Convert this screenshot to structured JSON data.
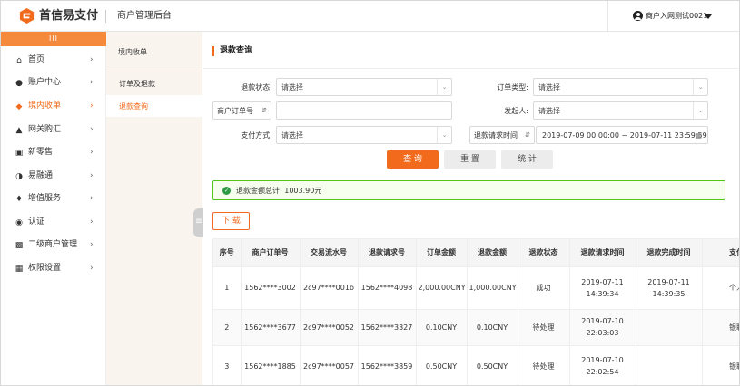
{
  "header": {
    "logo_text": "首信易支付",
    "system_title": "商户管理后台",
    "user_name": "商户入网测试0021"
  },
  "sidebar": {
    "collapse_glyph": "III",
    "items": [
      {
        "label": "首页",
        "icon": "home-icon"
      },
      {
        "label": "账户中心",
        "icon": "user-icon"
      },
      {
        "label": "境内收单",
        "icon": "layers-icon"
      },
      {
        "label": "网关购汇",
        "icon": "bank-icon"
      },
      {
        "label": "新零售",
        "icon": "cart-icon"
      },
      {
        "label": "易融通",
        "icon": "finance-icon"
      },
      {
        "label": "增值服务",
        "icon": "diamond-icon"
      },
      {
        "label": "认证",
        "icon": "certify-icon"
      },
      {
        "label": "二级商户管理",
        "icon": "merchant-icon"
      },
      {
        "label": "权限设置",
        "icon": "permission-icon"
      }
    ],
    "active_index": 2
  },
  "submenu": {
    "title": "境内收单",
    "items": [
      {
        "label": "订单及退款"
      },
      {
        "label": "退款查询"
      }
    ],
    "active_index": 1
  },
  "main": {
    "section_title": "退款查询",
    "filters": {
      "refund_status_label": "退款状态:",
      "refund_status_value": "请选择",
      "order_type_label": "订单类型:",
      "order_type_value": "请选择",
      "order_no_type": "商户订单号",
      "order_no_value": "",
      "initiator_label": "发起人:",
      "initiator_value": "请选择",
      "pay_method_label": "支付方式:",
      "pay_method_value": "请选择",
      "time_type": "退款请求时间",
      "date_start": "2019-07-09 00:00:00",
      "date_sep": "~",
      "date_end": "2019-07-11 23:59:59"
    },
    "buttons": {
      "query": "查 询",
      "reset": "重 置",
      "stats": "统 计",
      "download": "下 载"
    },
    "summary": "退款金额总计: 1003.90元"
  },
  "table": {
    "columns": [
      "序号",
      "商户订单号",
      "交易流水号",
      "退款请求号",
      "订单金额",
      "退款金额",
      "退款状态",
      "退款请求时间",
      "退款完成时间",
      "支付"
    ],
    "rows": [
      [
        "1",
        "1562****3002",
        "2c97****001b",
        "1562****4098",
        "2,000.00CNY",
        "1,000.00CNY",
        "成功",
        "2019-07-11 14:39:34",
        "2019-07-11 14:39:35",
        "个人"
      ],
      [
        "2",
        "1562****3677",
        "2c97****0052",
        "1562****3327",
        "0.10CNY",
        "0.10CNY",
        "待处理",
        "2019-07-10 22:03:03",
        "",
        "银联"
      ],
      [
        "3",
        "1562****1885",
        "2c97****0057",
        "1562****3859",
        "0.50CNY",
        "0.50CNY",
        "待处理",
        "2019-07-10 22:02:54",
        "",
        "银联"
      ]
    ]
  },
  "colors": {
    "accent": "#f26b1d",
    "success_border": "#52c41a",
    "success_bg": "#f6ffed"
  }
}
